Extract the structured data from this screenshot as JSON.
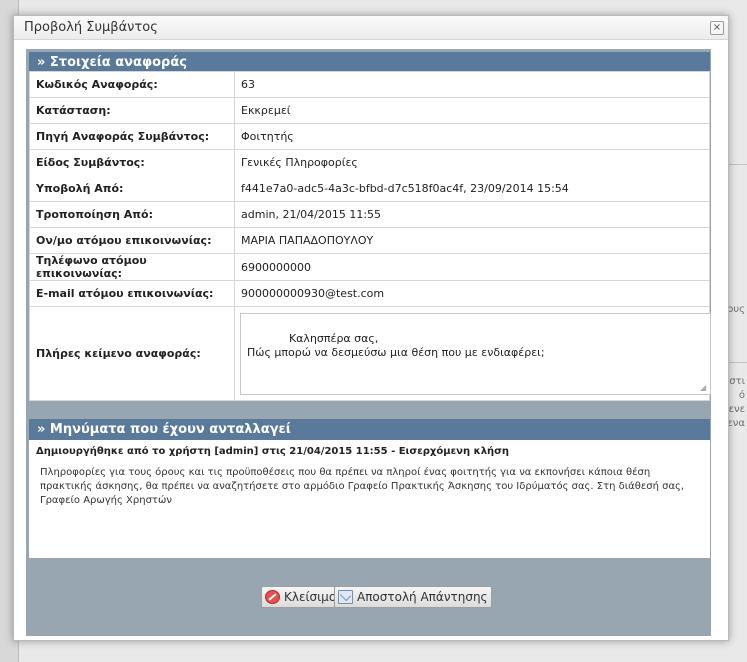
{
  "dialog": {
    "title": "Προβολή Συμβάντος",
    "close_glyph": "×"
  },
  "details": {
    "section_title": "» Στοιχεία αναφοράς",
    "rows": [
      {
        "label": "Κωδικός Αναφοράς:",
        "value": "63"
      },
      {
        "label": "Κατάσταση:",
        "value": "Εκκρεμεί"
      },
      {
        "label": "Πηγή Αναφοράς Συμβάντος:",
        "value": "Φοιτητής"
      },
      {
        "label": "Είδος Συμβάντος:",
        "value": "Γενικές Πληροφορίες"
      },
      {
        "label": "Υποβολή Από:",
        "value": "f441e7a0-adc5-4a3c-bfbd-d7c518f0ac4f, 23/09/2014 15:54"
      },
      {
        "label": "Τροποποίηση Από:",
        "value": "admin, 21/04/2015 11:55"
      },
      {
        "label": "Ον/μο ατόμου επικοινωνίας:",
        "value": "ΜΑΡΙΑ ΠΑΠΑΔΟΠΟΥΛΟΥ"
      },
      {
        "label": "Τηλέφωνο ατόμου επικοινωνίας:",
        "value": "6900000000"
      },
      {
        "label": "E-mail ατόμου επικοινωνίας:",
        "value": "900000000930@test.com"
      }
    ],
    "full_text_label": "Πλήρες κείμενο αναφοράς:",
    "full_text": "Καλησπέρα σας,\nΠώς μπορώ να δεσμεύσω μια θέση που με ενδιαφέρει;"
  },
  "messages": {
    "section_title": "» Μηνύματα που έχουν ανταλλαγεί",
    "items": [
      {
        "header": "Δημιουργήθηκε από το χρήστη [admin] στις 21/04/2015 11:55 - Εισερχόμενη κλήση",
        "body": "Πληροφορίες για τους όρους και τις προϋποθέσεις που θα πρέπει να πληροί ένας φοιτητής για να εκπονήσει κάποια θέση πρακτικής άσκησης, θα πρέπει να αναζητήσετε στο αρμόδιο Γραφείο Πρακτικής Άσκησης του Ιδρύματός σας. Στη διάθεσή σας, Γραφείο Αρωγής Χρηστών"
      }
    ]
  },
  "buttons": {
    "close_label": "Κλείσιμο",
    "reply_label": "Αποστολή Απάντησης"
  },
  "icons": {
    "close_button_icon": "no-entry-icon",
    "reply_button_icon": "envelope-icon"
  },
  "background": {
    "fragments": [
      "ους",
      "στι",
      "ό",
      "μενε",
      "ενα"
    ]
  }
}
